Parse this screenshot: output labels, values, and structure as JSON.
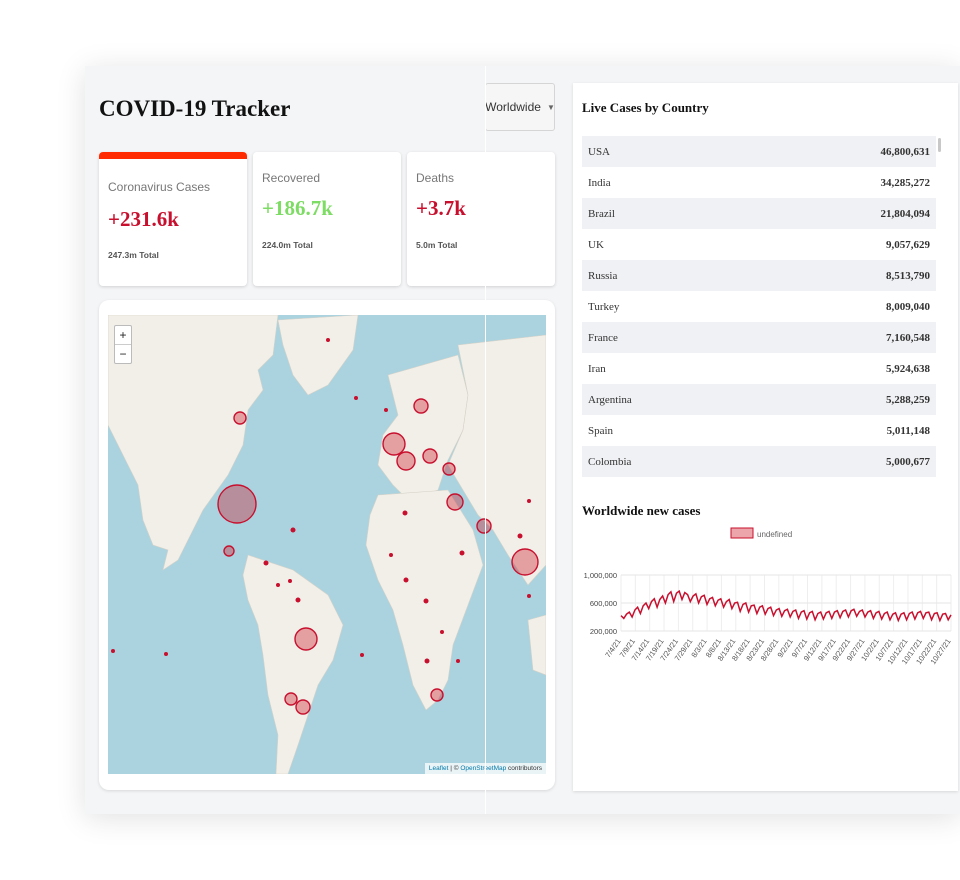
{
  "header": {
    "title": "COVID-19 Tracker",
    "dropdown": "Worldwide"
  },
  "cards": [
    {
      "label": "Coronavirus Cases",
      "value": "+231.6k",
      "total": "247.3m Total",
      "active": true
    },
    {
      "label": "Recovered",
      "value": "+186.7k",
      "total": "224.0m Total",
      "active": false
    },
    {
      "label": "Deaths",
      "value": "+3.7k",
      "total": "5.0m Total",
      "active": false
    }
  ],
  "map": {
    "zoom_in": "+",
    "zoom_out": "−",
    "attribution_leaflet": "Leaflet",
    "attribution_sep": " | © ",
    "attribution_osm": "OpenStreetMap",
    "attribution_tail": " contributors"
  },
  "live_cases": {
    "title": "Live Cases by Country",
    "rows": [
      {
        "country": "USA",
        "cases": "46,800,631"
      },
      {
        "country": "India",
        "cases": "34,285,272"
      },
      {
        "country": "Brazil",
        "cases": "21,804,094"
      },
      {
        "country": "UK",
        "cases": "9,057,629"
      },
      {
        "country": "Russia",
        "cases": "8,513,790"
      },
      {
        "country": "Turkey",
        "cases": "8,009,040"
      },
      {
        "country": "France",
        "cases": "7,160,548"
      },
      {
        "country": "Iran",
        "cases": "5,924,638"
      },
      {
        "country": "Argentina",
        "cases": "5,288,259"
      },
      {
        "country": "Spain",
        "cases": "5,011,148"
      },
      {
        "country": "Colombia",
        "cases": "5,000,677"
      }
    ]
  },
  "chart_title": "Worldwide new cases",
  "colors": {
    "accent_red": "#c8102e",
    "bar_red": "#ff2a00",
    "green": "#7ddc63",
    "map_water": "#aad3df",
    "map_land": "#f2efe9"
  },
  "chart_data": {
    "type": "line",
    "legend": [
      "undefined"
    ],
    "legend_position": "top",
    "yticks": [
      "1,000,000",
      "600,000",
      "200,000"
    ],
    "ylim": [
      200000,
      1000000
    ],
    "categories": [
      "7/4/21",
      "7/9/21",
      "7/14/21",
      "7/19/21",
      "7/24/21",
      "7/29/21",
      "8/3/21",
      "8/8/21",
      "8/13/21",
      "8/18/21",
      "8/23/21",
      "8/28/21",
      "9/2/21",
      "9/7/21",
      "9/12/21",
      "9/17/21",
      "9/22/21",
      "9/27/21",
      "10/2/21",
      "10/7/21",
      "10/12/21",
      "10/17/21",
      "10/22/21",
      "10/27/21"
    ],
    "series": [
      {
        "name": "undefined",
        "values": [
          420000,
          380000,
          440000,
          470000,
          400000,
          500000,
          540000,
          450000,
          560000,
          600000,
          520000,
          620000,
          660000,
          540000,
          650000,
          700000,
          600000,
          720000,
          760000,
          620000,
          740000,
          770000,
          650000,
          750000,
          720000,
          620000,
          700000,
          730000,
          600000,
          690000,
          710000,
          580000,
          660000,
          680000,
          560000,
          640000,
          660000,
          540000,
          620000,
          650000,
          520000,
          600000,
          610000,
          480000,
          580000,
          600000,
          470000,
          560000,
          570000,
          450000,
          540000,
          560000,
          440000,
          520000,
          540000,
          420000,
          500000,
          520000,
          410000,
          490000,
          510000,
          400000,
          480000,
          500000,
          380000,
          470000,
          490000,
          370000,
          460000,
          480000,
          360000,
          450000,
          470000,
          370000,
          460000,
          480000,
          380000,
          470000,
          490000,
          390000,
          480000,
          500000,
          400000,
          490000,
          510000,
          410000,
          480000,
          500000,
          400000,
          470000,
          490000,
          380000,
          460000,
          480000,
          370000,
          450000,
          470000,
          360000,
          440000,
          460000,
          350000,
          440000,
          460000,
          360000,
          450000,
          470000,
          370000,
          460000,
          480000,
          380000,
          460000,
          470000,
          360000,
          450000,
          460000,
          350000,
          440000,
          450000,
          360000,
          430000
        ]
      }
    ],
    "grid": true
  }
}
